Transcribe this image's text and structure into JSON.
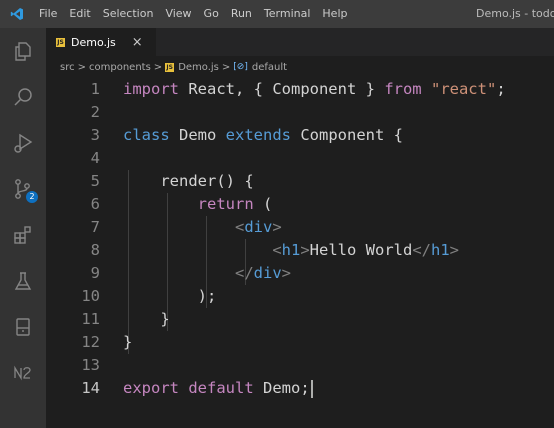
{
  "menu": {
    "items": [
      "File",
      "Edit",
      "Selection",
      "View",
      "Go",
      "Run",
      "Terminal",
      "Help"
    ],
    "window_title": "Demo.js - todoa"
  },
  "activity_bar": {
    "icons": [
      "explorer-icon",
      "search-icon",
      "run-debug-icon",
      "source-control-icon",
      "extensions-icon",
      "testing-icon",
      "remote-explorer-icon",
      "n2-extension-icon"
    ],
    "scm_badge": "2"
  },
  "tab": {
    "file_icon": "JS",
    "label": "Demo.js",
    "close": "×"
  },
  "breadcrumb": {
    "src": "src",
    "components": "components",
    "file": "Demo.js",
    "symbol_icon": "[⊘]",
    "symbol": "default",
    "sep": ">"
  },
  "editor": {
    "line_numbers": [
      "1",
      "2",
      "3",
      "4",
      "5",
      "6",
      "7",
      "8",
      "9",
      "10",
      "11",
      "12",
      "13",
      "14"
    ],
    "active_line": 14,
    "lines": [
      [
        [
          "kw-ctrl",
          "import"
        ],
        [
          "p",
          " React, { Component } "
        ],
        [
          "kw-ctrl",
          "from"
        ],
        [
          "p",
          " "
        ],
        [
          "str",
          "\"react\""
        ],
        [
          "p",
          ";"
        ]
      ],
      [],
      [
        [
          "kw",
          "class"
        ],
        [
          "p",
          " Demo "
        ],
        [
          "kw",
          "extends"
        ],
        [
          "p",
          " Component {"
        ]
      ],
      [],
      [
        [
          "p",
          "    render() {"
        ]
      ],
      [
        [
          "p",
          "        "
        ],
        [
          "kw-ctrl",
          "return"
        ],
        [
          "p",
          " ("
        ]
      ],
      [
        [
          "p",
          "            "
        ],
        [
          "tagb",
          "<"
        ],
        [
          "tag",
          "div"
        ],
        [
          "tagb",
          ">"
        ]
      ],
      [
        [
          "p",
          "                "
        ],
        [
          "tagb",
          "<"
        ],
        [
          "tag",
          "h1"
        ],
        [
          "tagb",
          ">"
        ],
        [
          "p",
          "Hello World"
        ],
        [
          "tagb",
          "</"
        ],
        [
          "tag",
          "h1"
        ],
        [
          "tagb",
          ">"
        ]
      ],
      [
        [
          "p",
          "            "
        ],
        [
          "tagb",
          "</"
        ],
        [
          "tag",
          "div"
        ],
        [
          "tagb",
          ">"
        ]
      ],
      [
        [
          "p",
          "        );"
        ]
      ],
      [
        [
          "p",
          "    }"
        ]
      ],
      [
        [
          "p",
          "}"
        ]
      ],
      [],
      [
        [
          "kw-ctrl",
          "export"
        ],
        [
          "p",
          " "
        ],
        [
          "kw-ctrl",
          "default"
        ],
        [
          "p",
          " Demo;"
        ]
      ]
    ]
  },
  "colors": {
    "editor_bg": "#1e1e1e",
    "activity_bar": "#333333",
    "title_bar": "#3c3c3c",
    "keyword_control": "#c586c0",
    "keyword": "#569cd6",
    "string": "#ce9178"
  }
}
